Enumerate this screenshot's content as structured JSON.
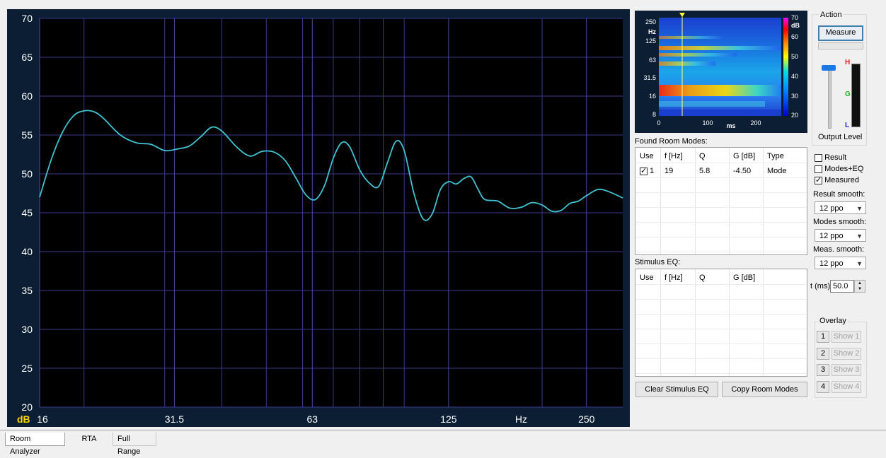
{
  "chart_data": {
    "type": "line",
    "x_scale": "log",
    "xlim": [
      16,
      300
    ],
    "ylim": [
      20,
      70
    ],
    "ylabel": "dB",
    "xlabel": "Hz",
    "y_ticks": [
      "70",
      "65",
      "60",
      "55",
      "50",
      "45",
      "40",
      "35",
      "30",
      "25",
      "20"
    ],
    "x_ticks": [
      "16",
      "31.5",
      "63",
      "125",
      "250"
    ],
    "grid": true,
    "color": "#3fc3d0",
    "x": [
      16,
      17,
      18,
      19,
      20,
      21,
      22,
      24,
      26,
      28,
      30,
      32,
      34,
      36,
      38,
      40,
      43,
      46,
      49,
      52,
      55,
      58,
      61,
      64,
      67,
      70,
      73,
      76,
      80,
      84,
      88,
      92,
      96,
      100,
      105,
      110,
      115,
      120,
      125,
      130,
      135,
      140,
      145,
      150,
      160,
      170,
      180,
      190,
      200,
      210,
      220,
      230,
      240,
      250,
      265,
      280,
      300
    ],
    "y": [
      47,
      52,
      55.5,
      57.5,
      58.1,
      58,
      57.2,
      55,
      54,
      53.8,
      53,
      53.2,
      53.6,
      54.8,
      56,
      55.5,
      53.5,
      52.3,
      52.9,
      52.8,
      51.7,
      49.5,
      47.3,
      46.7,
      48.5,
      52,
      54,
      53.5,
      50.5,
      48.8,
      48.4,
      51.5,
      54.2,
      53,
      47.5,
      44.2,
      44.8,
      48,
      49,
      48.7,
      49.4,
      49.6,
      48,
      46.7,
      46.5,
      45.6,
      45.7,
      46.3,
      46,
      45.2,
      45.3,
      46.2,
      46.5,
      47.2,
      48,
      47.7,
      46.9
    ]
  },
  "spectrogram": {
    "y_ticks": [
      "250",
      "Hz",
      "125",
      "63",
      "31.5",
      "16",
      "8"
    ],
    "x_ticks": [
      "0",
      "100",
      "ms",
      "200"
    ],
    "scale_ticks": [
      "70",
      "dB",
      "60",
      "50",
      "40",
      "30",
      "20"
    ]
  },
  "action": {
    "title": "Action",
    "measure_label": "Measure",
    "output_level_label": "Output Level",
    "meter_h": "H",
    "meter_g": "G",
    "meter_l": "L"
  },
  "room_modes": {
    "title": "Found Room Modes:",
    "headers": [
      "Use",
      "f [Hz]",
      "Q",
      "G [dB]",
      "Type"
    ],
    "rows": [
      {
        "use": "1",
        "f": "19",
        "q": "5.8",
        "g": "-4.50",
        "type": "Mode"
      }
    ]
  },
  "stimulus_eq": {
    "title": "Stimulus EQ:",
    "headers": [
      "Use",
      "f [Hz]",
      "Q",
      "G [dB]"
    ]
  },
  "options": {
    "result": "Result",
    "modes_eq": "Modes+EQ",
    "measured": "Measured",
    "result_smooth_label": "Result smooth:",
    "result_smooth": "12 ppo",
    "modes_smooth_label": "Modes smooth:",
    "modes_smooth": "12 ppo",
    "meas_smooth_label": "Meas. smooth:",
    "meas_smooth": "12 ppo",
    "t_label": "t (ms)",
    "t_value": "50.0"
  },
  "overlay": {
    "title": "Overlay",
    "items": [
      {
        "num": "1",
        "label": "Show 1"
      },
      {
        "num": "2",
        "label": "Show 2"
      },
      {
        "num": "3",
        "label": "Show 3"
      },
      {
        "num": "4",
        "label": "Show 4"
      }
    ]
  },
  "buttons": {
    "clear_eq": "Clear Stimulus EQ",
    "copy_modes": "Copy Room Modes"
  },
  "tabs": [
    "Room Analyzer",
    "RTA",
    "Full Range"
  ]
}
